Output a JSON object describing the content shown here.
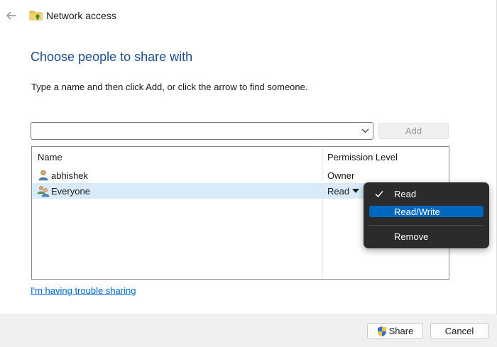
{
  "window": {
    "title": "Network access",
    "heading": "Choose people to share with",
    "instruction": "Type a name and then click Add, or click the arrow to find someone."
  },
  "name_input": {
    "value": "",
    "placeholder": ""
  },
  "add_button": {
    "label": "Add",
    "enabled": false
  },
  "list": {
    "columns": {
      "name": "Name",
      "permission": "Permission Level"
    },
    "rows": [
      {
        "name": "abhishek",
        "permission": "Owner",
        "icon": "user-icon",
        "selected": false
      },
      {
        "name": "Everyone",
        "permission": "Read",
        "icon": "users-group-icon",
        "selected": true
      }
    ]
  },
  "permission_menu": {
    "items": [
      {
        "label": "Read",
        "checked": true,
        "highlighted": false
      },
      {
        "label": "Read/Write",
        "checked": false,
        "highlighted": true
      },
      {
        "label": "Remove",
        "checked": false,
        "highlighted": false
      }
    ]
  },
  "trouble_link": "I'm having trouble sharing",
  "buttons": {
    "share": "Share",
    "cancel": "Cancel"
  },
  "colors": {
    "heading": "#1f4e8c",
    "link": "#0066cc",
    "selected_row": "#d9ebf9",
    "menu_background": "#2b2b2b",
    "menu_highlight": "#0067c0",
    "footer": "#f0f0f0"
  },
  "icons": {
    "back": "back-arrow-icon",
    "title": "shared-folder-icon",
    "combo": "chevron-down-icon",
    "share": "uac-shield-icon",
    "check": "checkmark-icon"
  }
}
